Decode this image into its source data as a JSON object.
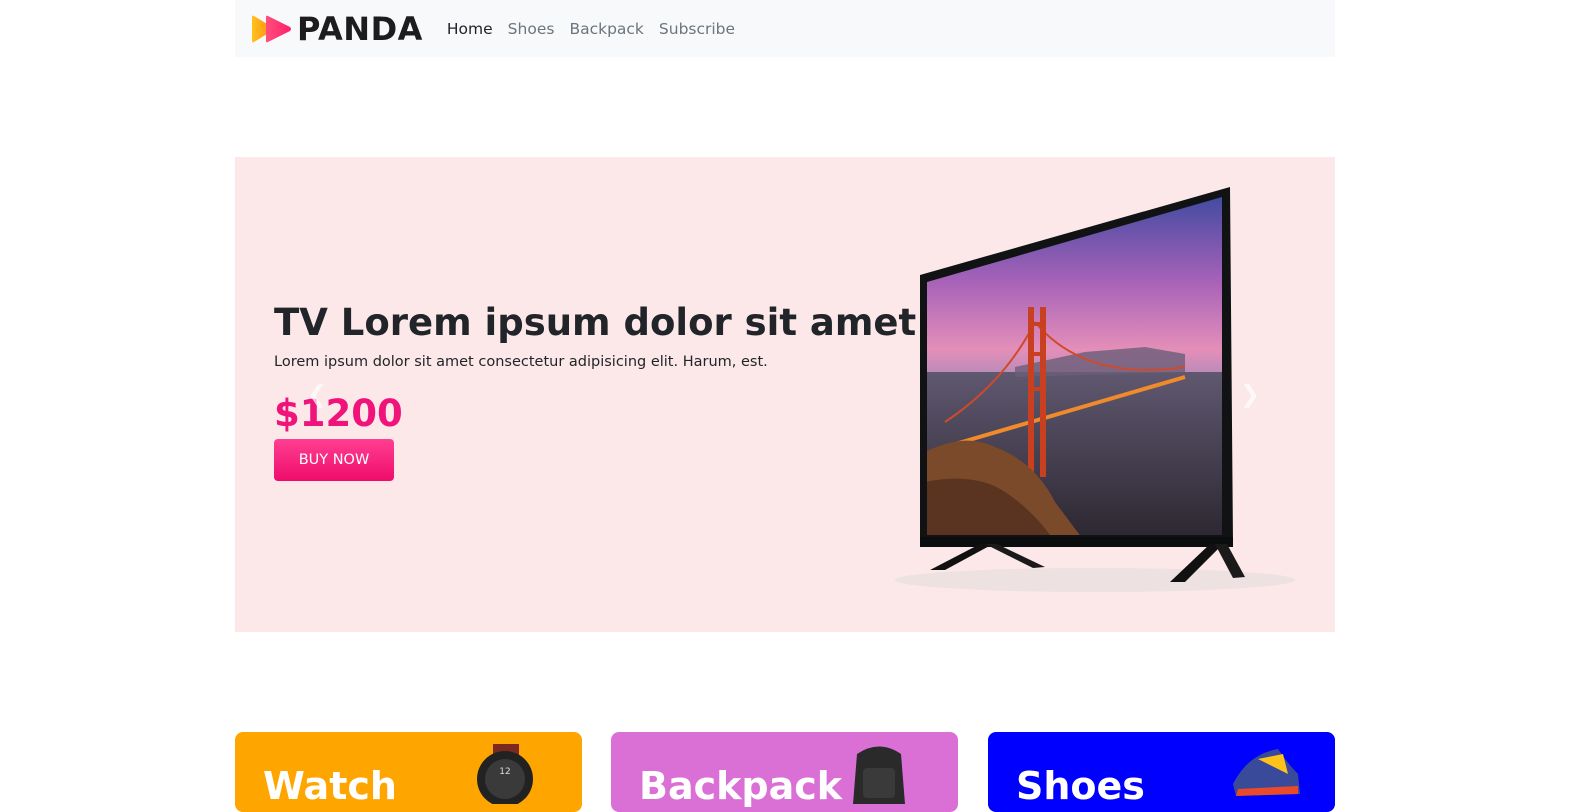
{
  "nav": {
    "brand": "PANDA",
    "links": [
      {
        "label": "Home",
        "active": true
      },
      {
        "label": "Shoes",
        "active": false
      },
      {
        "label": "Backpack",
        "active": false
      },
      {
        "label": "Subscribe",
        "active": false
      }
    ]
  },
  "hero": {
    "title": "TV Lorem ipsum dolor sit amet.",
    "subtitle": "Lorem ipsum dolor sit amet consectetur adipisicing elit. Harum, est.",
    "price": "$1200",
    "button": "BUY NOW",
    "prev_icon": "chevron-left-icon",
    "next_icon": "chevron-right-icon",
    "background": "#fce8e8",
    "accent": "#f0147a"
  },
  "categories": [
    {
      "title": "Watch",
      "color": "#ffa500"
    },
    {
      "title": "Backpack",
      "color": "#da70d6"
    },
    {
      "title": "Shoes",
      "color": "#0000ff"
    }
  ]
}
